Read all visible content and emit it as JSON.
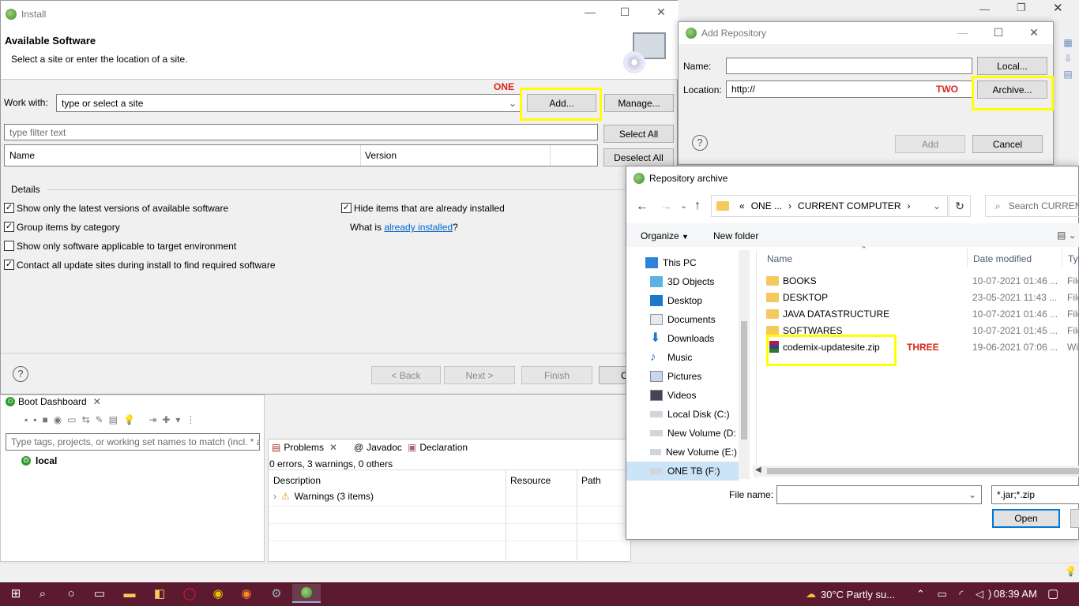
{
  "install": {
    "title": "Install",
    "heading": "Available Software",
    "subtitle": "Select a site or enter the location of a site.",
    "work_with_label": "Work with:",
    "work_with_value": "type or select a site",
    "add_button": "Add...",
    "manage_button": "Manage...",
    "filter_placeholder": "type filter text",
    "select_all": "Select All",
    "deselect_all": "Deselect All",
    "col_name": "Name",
    "col_version": "Version",
    "details_label": "Details",
    "opt_latest": "Show only the latest versions of available software",
    "opt_group": "Group items by category",
    "opt_applicable": "Show only software applicable to target environment",
    "opt_contact": "Contact all update sites during install to find required software",
    "opt_hide": "Hide items that are already installed",
    "what_is": "What is ",
    "already_installed": "already installed",
    "q_mark": "?",
    "back": "< Back",
    "next": "Next >",
    "finish": "Finish",
    "cancel_partial": "C",
    "annotation_one": "ONE"
  },
  "add_repo": {
    "title": "Add Repository",
    "name_label": "Name:",
    "location_label": "Location:",
    "location_value": "http://",
    "local_button": "Local...",
    "archive_button": "Archive...",
    "add_button": "Add",
    "cancel_button": "Cancel",
    "annotation_two": "TWO"
  },
  "archive": {
    "title": "Repository archive",
    "breadcrumb": [
      "ONE ...",
      "CURRENT COMPUTER"
    ],
    "breadcrumb_prefix": "«",
    "search_placeholder": "Search CURREN",
    "organize": "Organize",
    "new_folder": "New folder",
    "nav_items": [
      {
        "label": "This PC",
        "icon": "computer-icon"
      },
      {
        "label": "3D Objects",
        "icon": "cube-icon"
      },
      {
        "label": "Desktop",
        "icon": "desktop-icon"
      },
      {
        "label": "Documents",
        "icon": "document-icon"
      },
      {
        "label": "Downloads",
        "icon": "download-icon"
      },
      {
        "label": "Music",
        "icon": "music-icon"
      },
      {
        "label": "Pictures",
        "icon": "picture-icon"
      },
      {
        "label": "Videos",
        "icon": "video-icon"
      },
      {
        "label": "Local Disk (C:)",
        "icon": "drive-icon"
      },
      {
        "label": "New Volume (D:",
        "icon": "drive-icon"
      },
      {
        "label": "New Volume (E:)",
        "icon": "drive-icon"
      },
      {
        "label": "ONE TB (F:)",
        "icon": "drive-icon"
      }
    ],
    "col_name": "Name",
    "col_date": "Date modified",
    "col_type": "Typ",
    "files": [
      {
        "name": "BOOKS",
        "date": "10-07-2021 01:46 ...",
        "type": "File"
      },
      {
        "name": "DESKTOP",
        "date": "23-05-2021 11:43 ...",
        "type": "File"
      },
      {
        "name": "JAVA DATASTRUCTURE",
        "date": "10-07-2021 01:46 ...",
        "type": "File"
      },
      {
        "name": "SOFTWARES",
        "date": "10-07-2021 01:45 ...",
        "type": "File"
      },
      {
        "name": "codemix-updatesite.zip",
        "date": "19-06-2021 07:06 ...",
        "type": "Wi"
      }
    ],
    "file_name_label": "File name:",
    "filter_value": "*.jar;*.zip",
    "open_button": "Open",
    "annotation_three": "THREE"
  },
  "boot": {
    "title": "Boot Dashboard",
    "filter_placeholder": "Type tags, projects, or working set names to match (incl. * a",
    "item": "local"
  },
  "problems": {
    "tab_problems": "Problems",
    "tab_javadoc": "Javadoc",
    "tab_declaration": "Declaration",
    "summary": "0 errors, 3 warnings, 0 others",
    "col_description": "Description",
    "col_resource": "Resource",
    "col_path": "Path",
    "warnings": "Warnings (3 items)"
  },
  "taskbar": {
    "weather": "30°C  Partly su...",
    "time": "08:39 AM"
  },
  "colors": {
    "highlight": "#ffff00",
    "annotation": "#d9261c",
    "link": "#0066cc",
    "taskbar": "#5c1a30"
  }
}
